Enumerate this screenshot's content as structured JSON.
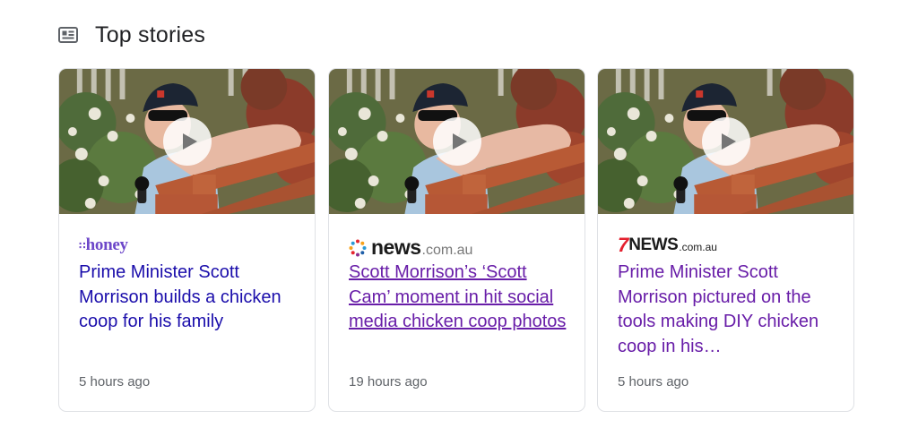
{
  "section": {
    "icon": "news-icon",
    "title": "Top stories"
  },
  "stories": [
    {
      "source": {
        "logo": "honey",
        "prefix": "∷",
        "name": "honey"
      },
      "headline": "Prime Minister Scott Morrison builds a chicken coop for his family",
      "time": "5 hours ago",
      "play_icon": "play-icon"
    },
    {
      "source": {
        "logo": "news.com.au",
        "main": "news",
        "suffix": ".com.au"
      },
      "headline": "Scott Morrison’s ‘Scott Cam’ moment in hit social media chicken coop photos",
      "time": "19 hours ago",
      "play_icon": "play-icon"
    },
    {
      "source": {
        "logo": "7NEWS.com.au",
        "mark": "7",
        "main": "NEWS",
        "suffix": ".com.au"
      },
      "headline": "Prime Minister Scott Morrison pictured on the tools making DIY chicken coop in his…",
      "time": "5 hours ago",
      "play_icon": "play-icon"
    }
  ],
  "colors": {
    "link": "#1a0dab",
    "visited": "#681da8",
    "honey": "#6d47c9",
    "seven_red": "#e4202e",
    "muted": "#5f6368"
  }
}
